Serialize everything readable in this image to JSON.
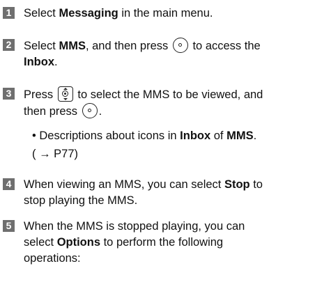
{
  "steps": [
    {
      "num": "1",
      "a": "Select ",
      "b1": "Messaging",
      "c": " in the main menu."
    },
    {
      "num": "2",
      "a": "Select ",
      "b1": "MMS",
      "c": ", and then press",
      "d": "to access the",
      "b2": "Inbox",
      "e": "."
    },
    {
      "num": "3",
      "a": "Press",
      "c": "to select the MMS to be viewed, and",
      "d": "then press",
      "e": "."
    },
    {
      "num": "4",
      "a": "When viewing an MMS, you can select ",
      "b1": "Stop",
      "c": " to",
      "d": "stop playing the MMS."
    },
    {
      "num": "5",
      "a": "When the MMS is stopped playing, you can",
      "d": "select ",
      "b1": "Options",
      "c": " to perform the following",
      "e": "operations:"
    }
  ],
  "note": {
    "bullet": "•",
    "a": "Descriptions about icons in ",
    "b1": "Inbox",
    "c": " of ",
    "b2": "MMS",
    "d": ".",
    "ref": "( → P77)"
  },
  "icons": [
    "ok-key-icon",
    "navigation-key-icon"
  ]
}
